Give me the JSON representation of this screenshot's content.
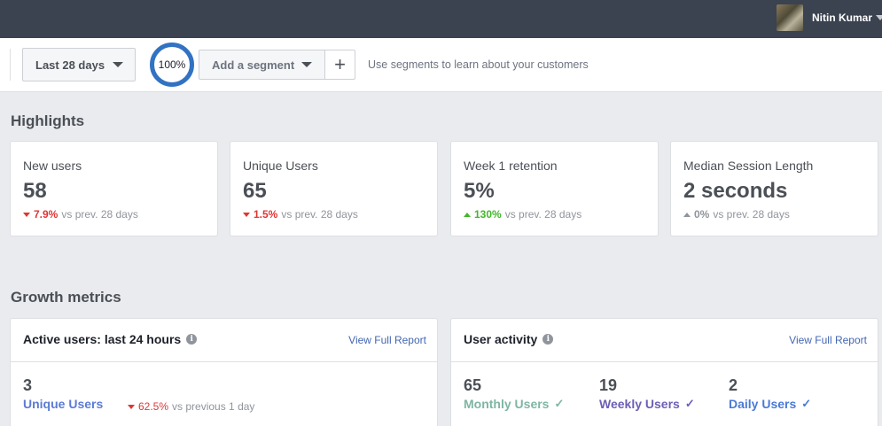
{
  "user": {
    "name": "Nitin Kumar"
  },
  "toolbar": {
    "date_range": "Last 28 days",
    "zoom": "100%",
    "segment_label": "Add a segment",
    "plus_label": "+",
    "segment_hint": "Use segments to learn about your customers"
  },
  "highlights": {
    "title": "Highlights",
    "cards": [
      {
        "label": "New users",
        "value": "58",
        "change": "7.9%",
        "direction": "down",
        "note": "vs prev. 28 days"
      },
      {
        "label": "Unique Users",
        "value": "65",
        "change": "1.5%",
        "direction": "down",
        "note": "vs prev. 28 days"
      },
      {
        "label": "Week 1 retention",
        "value": "5%",
        "change": "130%",
        "direction": "up",
        "note": "vs prev. 28 days"
      },
      {
        "label": "Median Session Length",
        "value": "2 seconds",
        "change": "0%",
        "direction": "neutral",
        "note": "vs prev. 28 days"
      }
    ]
  },
  "growth": {
    "title": "Growth metrics",
    "active": {
      "title": "Active users: last 24 hours",
      "link": "View Full Report",
      "value": "3",
      "label": "Unique Users",
      "change": "62.5%",
      "note": "vs previous 1 day"
    },
    "activity": {
      "title": "User activity",
      "link": "View Full Report",
      "monthly": {
        "value": "65",
        "label": "Monthly Users"
      },
      "weekly": {
        "value": "19",
        "label": "Weekly Users"
      },
      "daily": {
        "value": "2",
        "label": "Daily Users"
      }
    }
  },
  "colors": {
    "topbar": "#3b4350",
    "zoom_ring": "#3173c2",
    "down": "#e03535",
    "up": "#42b72a",
    "link": "#4267b2",
    "unique_users": "#5b7bd5",
    "monthly": "#7fb5a4",
    "weekly": "#6b5fb5",
    "daily": "#4a79d6"
  }
}
